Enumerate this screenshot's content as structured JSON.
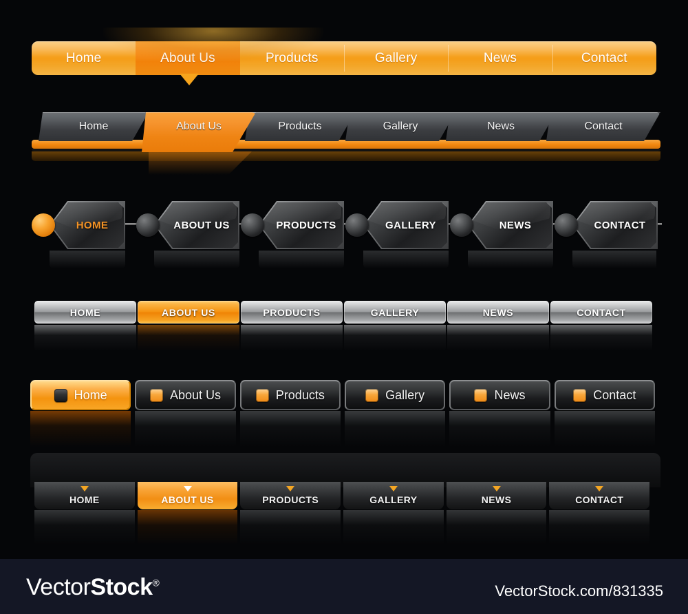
{
  "background_color": "#050608",
  "accent_color": "#f5a01e",
  "menus": [
    {
      "id": "orange-bar",
      "style": "solid-orange-bar",
      "active_index": 1,
      "items": [
        {
          "label": "Home"
        },
        {
          "label": "About Us"
        },
        {
          "label": "Products"
        },
        {
          "label": "Gallery"
        },
        {
          "label": "News"
        },
        {
          "label": "Contact"
        }
      ]
    },
    {
      "id": "slanted-tabs",
      "style": "dark-slanted-tabs-with-orange-rule",
      "active_index": 1,
      "items": [
        {
          "label": "Home"
        },
        {
          "label": "About Us"
        },
        {
          "label": "Products"
        },
        {
          "label": "Gallery"
        },
        {
          "label": "News"
        },
        {
          "label": "Contact"
        }
      ]
    },
    {
      "id": "tag-buttons",
      "style": "dark-tag-shapes-with-connector-dots",
      "active_index": 0,
      "items": [
        {
          "label": "HOME"
        },
        {
          "label": "ABOUT US"
        },
        {
          "label": "PRODUCTS"
        },
        {
          "label": "GALLERY"
        },
        {
          "label": "NEWS"
        },
        {
          "label": "CONTACT"
        }
      ]
    },
    {
      "id": "silver-buttons",
      "style": "metallic-silver-pills",
      "active_index": 1,
      "items": [
        {
          "label": "HOME"
        },
        {
          "label": "ABOUT US"
        },
        {
          "label": "PRODUCTS"
        },
        {
          "label": "GALLERY"
        },
        {
          "label": "NEWS"
        },
        {
          "label": "CONTACT"
        }
      ]
    },
    {
      "id": "icon-buttons",
      "style": "dark-rounded-buttons-with-square-icon",
      "active_index": 0,
      "items": [
        {
          "label": "Home"
        },
        {
          "label": "About Us"
        },
        {
          "label": "Products"
        },
        {
          "label": "Gallery"
        },
        {
          "label": "News"
        },
        {
          "label": "Contact"
        }
      ]
    },
    {
      "id": "arrow-tabs",
      "style": "dark-tabs-with-down-arrow-marker",
      "active_index": 1,
      "items": [
        {
          "label": "HOME"
        },
        {
          "label": "ABOUT US"
        },
        {
          "label": "PRODUCTS"
        },
        {
          "label": "GALLERY"
        },
        {
          "label": "NEWS"
        },
        {
          "label": "CONTACT"
        }
      ]
    }
  ],
  "footer": {
    "brand_first": "Vector",
    "brand_second": "Stock",
    "registered_mark": "®",
    "url": "VectorStock.com/831335"
  }
}
